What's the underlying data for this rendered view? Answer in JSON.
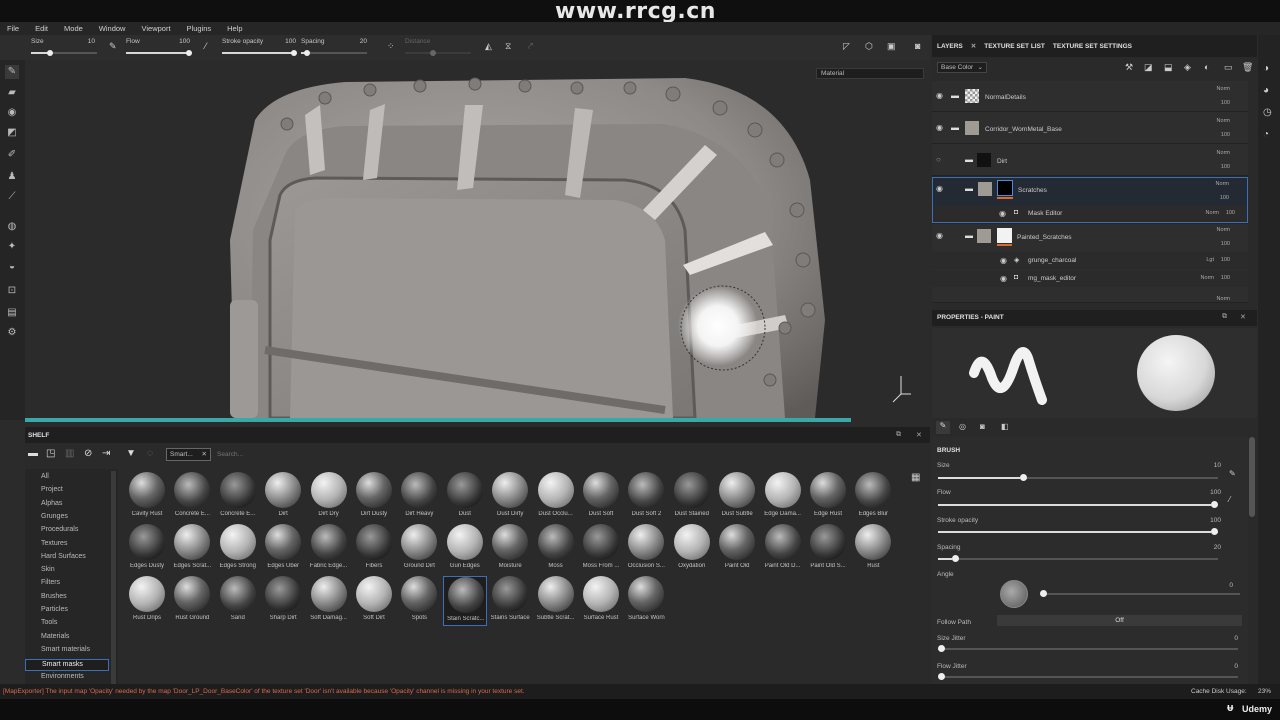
{
  "watermark": "www.rrcg.cn",
  "menu": [
    "File",
    "Edit",
    "Mode",
    "Window",
    "Viewport",
    "Plugins",
    "Help"
  ],
  "toolbar": {
    "size_label": "Size",
    "size_value": "10",
    "flow_label": "Flow",
    "flow_value": "100",
    "stroke_label": "Stroke opacity",
    "stroke_value": "100",
    "spacing_label": "Spacing",
    "spacing_value": "20",
    "distance_label": "Distance"
  },
  "viewport": {
    "material_select": "Material"
  },
  "layers_panel": {
    "tabs": [
      "LAYERS",
      "TEXTURE SET LIST",
      "TEXTURE SET SETTINGS"
    ],
    "channel": "Base Color",
    "layers": [
      {
        "name": "NormalDetails",
        "blend": "Norm",
        "opacity": "100"
      },
      {
        "name": "Corridor_WornMetal_Base",
        "blend": "Norm",
        "opacity": "100"
      },
      {
        "name": "Dirt",
        "blend": "Norm",
        "opacity": "100"
      },
      {
        "name": "Scratches",
        "blend": "Norm",
        "opacity": "100"
      },
      {
        "name": "Mask Editor",
        "blend": "Norm",
        "opacity": "100"
      },
      {
        "name": "Painted_Scratches",
        "blend": "Norm",
        "opacity": "100"
      },
      {
        "name": "grunge_charcoal",
        "blend": "Lgt",
        "opacity": "100"
      },
      {
        "name": "mg_mask_editor",
        "blend": "Norm",
        "opacity": "100"
      },
      {
        "name": "",
        "blend": "Norm",
        "opacity": ""
      }
    ]
  },
  "properties": {
    "title": "PROPERTIES - PAINT",
    "section": "BRUSH",
    "size_label": "Size",
    "size_value": "10",
    "size_frac": 0.3,
    "flow_label": "Flow",
    "flow_value": "100",
    "flow_frac": 1.0,
    "stroke_label": "Stroke opacity",
    "stroke_value": "100",
    "stroke_frac": 1.0,
    "spacing_label": "Spacing",
    "spacing_value": "20",
    "spacing_frac": 0.05,
    "angle_label": "Angle",
    "angle_value": "0",
    "follow_label": "Follow Path",
    "follow_value": "Off",
    "sizejitter_label": "Size Jitter",
    "sizejitter_value": "0",
    "flowjitter_label": "Flow Jitter",
    "flowjitter_value": "0"
  },
  "shelf": {
    "title": "SHELF",
    "filter_tag": "Smart...",
    "search_placeholder": "Search...",
    "categories": [
      "All",
      "Project",
      "Alphas",
      "Grunges",
      "Procedurals",
      "Textures",
      "Hard Surfaces",
      "Skin",
      "Filters",
      "Brushes",
      "Particles",
      "Tools",
      "Materials",
      "Smart materials",
      "Smart masks",
      "Environments"
    ],
    "selected_category": "Smart masks",
    "items": [
      "Cavity Rust",
      "Concrete E...",
      "Concrete E...",
      "Dirt",
      "Dirt Dry",
      "Dirt Dusty",
      "Dirt Heavy",
      "Dust",
      "Dust Dirty",
      "Dust Occlu...",
      "Dust Soft",
      "Dust Soft 2",
      "Dust Stained",
      "Dust Subtle",
      "Edge Dama...",
      "Edge Rust",
      "Edges Blur",
      "Edges Dusty",
      "Edges Scrat...",
      "Edges Strong",
      "Edges Uber",
      "Fabric Edge...",
      "Fibers",
      "Ground Dirt",
      "Gun Edges",
      "Moisture",
      "Moss",
      "Moss From ...",
      "Occlusion S...",
      "Oxydation",
      "Paint Old",
      "Paint Old D...",
      "Paint Old S...",
      "Rust",
      "Rust Drips",
      "Rust Ground",
      "Sand",
      "Sharp Dirt",
      "Soft Damag...",
      "Soft Dirt",
      "Spots",
      "Stain Scratc...",
      "Stains Surface",
      "Subtle Scrat...",
      "Surface Rust",
      "Surface Worn"
    ],
    "selected_item": "Stain Scratc..."
  },
  "status": {
    "message": "[MapExporter] The input map 'Opacity' needed by the map 'Door_LP_Door_BaseColor' of the texture set 'Door' isn't available because 'Opacity' channel is missing in your texture set.",
    "cache_label": "Cache Disk Usage:",
    "cache_value": "23%"
  },
  "brand": "Udemy",
  "colors": {
    "accent": "#3aa8a8",
    "selection": "#3b6fb8",
    "error": "#d86a4a"
  }
}
